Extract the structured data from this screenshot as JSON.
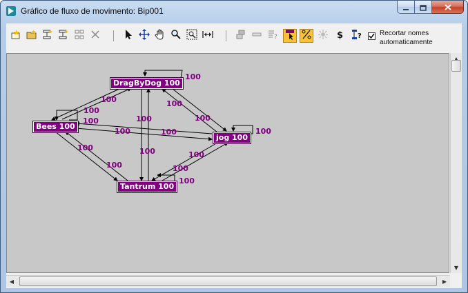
{
  "window": {
    "title": "Gráfico de fluxo de movimento: Bip001",
    "buttons": [
      "minimize-icon",
      "maximize-icon",
      "close-icon"
    ]
  },
  "toolbar": {
    "icons": [
      "create-clip-icon",
      "open-file-icon",
      "add-transition-icon",
      "remove-transition-icon",
      "select-all-icon",
      "delete-icon",
      "select-icon",
      "move-icon",
      "pan-hand-icon",
      "zoom-icon",
      "zoom-region-icon",
      "fit-horizontal-icon",
      "create-random-motion-icon",
      "clip-properties-icon",
      "optimize-icon",
      "show-selected-icon",
      "percent-icon",
      "animated-start-icon",
      "cost-icon",
      "flow-info-icon"
    ],
    "active": [
      "show-selected-icon",
      "percent-icon"
    ],
    "checkbox": {
      "checked": true,
      "label_line1": "Recortar nomes",
      "label_line2": "automaticamente"
    }
  },
  "graph": {
    "nodes": [
      {
        "id": "dragbydog",
        "label": "DragByDog 100"
      },
      {
        "id": "bees",
        "label": "Bees 100"
      },
      {
        "id": "jog",
        "label": "jog 100"
      },
      {
        "id": "tantrum",
        "label": "Tantrum 100"
      }
    ],
    "edge_labels": [
      "100",
      "100",
      "100",
      "100",
      "100",
      "100",
      "100",
      "100",
      "100",
      "100",
      "100",
      "100",
      "100",
      "100",
      "100",
      "100"
    ]
  },
  "colors": {
    "node_fill": "#800080",
    "edge_label": "#800080",
    "canvas": "#c8c8c8",
    "active_button": "#f8c23a"
  }
}
